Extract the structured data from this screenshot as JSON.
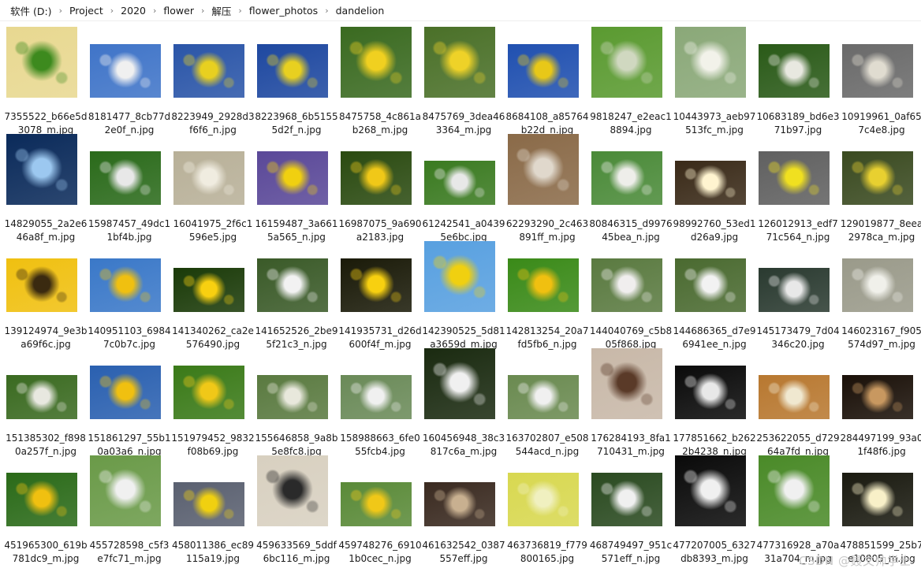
{
  "breadcrumb": [
    "软件 (D:)",
    "Project",
    "2020",
    "flower",
    "解压",
    "flower_photos",
    "dandelion"
  ],
  "files": [
    {
      "name": "7355522_b66e5d3078_m.jpg",
      "bg": "#e8d890",
      "fg": "#3d8a1e",
      "shape": "portrait"
    },
    {
      "name": "8181477_8cb77d2e0f_n.jpg",
      "bg": "#3f74c8",
      "fg": "#f0f0f0",
      "shape": "landscape"
    },
    {
      "name": "8223949_2928d3f6f6_n.jpg",
      "bg": "#2a55a8",
      "fg": "#e8d020",
      "shape": "landscape"
    },
    {
      "name": "8223968_6b51555d2f_n.jpg",
      "bg": "#1e48a0",
      "fg": "#e8d020",
      "shape": "landscape"
    },
    {
      "name": "8475758_4c861ab268_m.jpg",
      "bg": "#3a6a20",
      "fg": "#f0d020",
      "shape": "portrait"
    },
    {
      "name": "8475769_3dea463364_m.jpg",
      "bg": "#4a7028",
      "fg": "#eed228",
      "shape": "portrait"
    },
    {
      "name": "8684108_a85764b22d_n.jpg",
      "bg": "#2050b0",
      "fg": "#e8c818",
      "shape": "landscape"
    },
    {
      "name": "9818247_e2eac18894.jpg",
      "bg": "#5a9a30",
      "fg": "#d0d8c0",
      "shape": "square"
    },
    {
      "name": "10443973_aeb97513fc_m.jpg",
      "bg": "#8aa878",
      "fg": "#f2f2ea",
      "shape": "portrait"
    },
    {
      "name": "10683189_bd6e371b97.jpg",
      "bg": "#2a5a18",
      "fg": "#e8e8e0",
      "shape": "landscape"
    },
    {
      "name": "10919961_0af657c4e8.jpg",
      "bg": "#6a6a6a",
      "fg": "#e0dcd0",
      "shape": "landscape"
    },
    {
      "name": "14829055_2a2e646a8f_m.jpg",
      "bg": "#0a2a5a",
      "fg": "#9cc8f0",
      "shape": "square"
    },
    {
      "name": "15987457_49dc11bf4b.jpg",
      "bg": "#2a6a1a",
      "fg": "#e8e8e8",
      "shape": "landscape"
    },
    {
      "name": "16041975_2f6c1596e5.jpg",
      "bg": "#b8b098",
      "fg": "#f0ece0",
      "shape": "landscape"
    },
    {
      "name": "16159487_3a6615a565_n.jpg",
      "bg": "#5a4898",
      "fg": "#f0d010",
      "shape": "landscape"
    },
    {
      "name": "16987075_9a690a2183.jpg",
      "bg": "#2a4a10",
      "fg": "#f0c818",
      "shape": "landscape"
    },
    {
      "name": "61242541_a04395e6bc.jpg",
      "bg": "#3a7a20",
      "fg": "#e8e8e8",
      "shape": "wide"
    },
    {
      "name": "62293290_2c463891ff_m.jpg",
      "bg": "#8a6a48",
      "fg": "#e0d8cc",
      "shape": "portrait"
    },
    {
      "name": "80846315_d997645bea_n.jpg",
      "bg": "#4a8a38",
      "fg": "#eeeeea",
      "shape": "landscape"
    },
    {
      "name": "98992760_53ed1d26a9.jpg",
      "bg": "#3a2a18",
      "fg": "#fff4d0",
      "shape": "wide"
    },
    {
      "name": "126012913_edf771c564_n.jpg",
      "bg": "#606060",
      "fg": "#f0e020",
      "shape": "landscape"
    },
    {
      "name": "129019877_8eea2978ca_m.jpg",
      "bg": "#3a4a20",
      "fg": "#e8d030",
      "shape": "landscape"
    },
    {
      "name": "139124974_9e3ba69f6c.jpg",
      "bg": "#f0c010",
      "fg": "#3a2a10",
      "shape": "landscape"
    },
    {
      "name": "140951103_69847c0b7c.jpg",
      "bg": "#3a78c8",
      "fg": "#f0c010",
      "shape": "landscape"
    },
    {
      "name": "141340262_ca2e576490.jpg",
      "bg": "#1a3a08",
      "fg": "#f8d010",
      "shape": "wide"
    },
    {
      "name": "141652526_2be95f21c3_n.jpg",
      "bg": "#3a5a28",
      "fg": "#f2f2f2",
      "shape": "landscape"
    },
    {
      "name": "141935731_d26d600f4f_m.jpg",
      "bg": "#1a1a08",
      "fg": "#f8d010",
      "shape": "landscape"
    },
    {
      "name": "142390525_5d81a3659d_m.jpg",
      "bg": "#58a0e0",
      "fg": "#f0d010",
      "shape": "square"
    },
    {
      "name": "142813254_20a7fd5fb6_n.jpg",
      "bg": "#3a8a18",
      "fg": "#f0c010",
      "shape": "landscape"
    },
    {
      "name": "144040769_c5b805f868.jpg",
      "bg": "#5a7a40",
      "fg": "#f0eeee",
      "shape": "landscape"
    },
    {
      "name": "144686365_d7e96941ee_n.jpg",
      "bg": "#4a6a30",
      "fg": "#f2f2f2",
      "shape": "landscape"
    },
    {
      "name": "145173479_7d04346c20.jpg",
      "bg": "#2a3a30",
      "fg": "#e8e8e8",
      "shape": "wide"
    },
    {
      "name": "146023167_f905574d97_m.jpg",
      "bg": "#9a9a8a",
      "fg": "#f0f0ea",
      "shape": "landscape"
    },
    {
      "name": "151385302_f8980a257f_n.jpg",
      "bg": "#3a6a20",
      "fg": "#e8e8e0",
      "shape": "wide"
    },
    {
      "name": "151861297_55b10a03a6_n.jpg",
      "bg": "#2a60b0",
      "fg": "#f0c010",
      "shape": "landscape"
    },
    {
      "name": "151979452_9832f08b69.jpg",
      "bg": "#3a7a18",
      "fg": "#f0c818",
      "shape": "landscape"
    },
    {
      "name": "155646858_9a8b5e8fc8.jpg",
      "bg": "#5a7a40",
      "fg": "#e8e8dc",
      "shape": "wide"
    },
    {
      "name": "158988663_6fe055fcb4.jpg",
      "bg": "#6a8a58",
      "fg": "#f0f0f0",
      "shape": "wide"
    },
    {
      "name": "160456948_38c3817c6a_m.jpg",
      "bg": "#1a2a10",
      "fg": "#f0f0f0",
      "shape": "portrait"
    },
    {
      "name": "163702807_e508544acd_n.jpg",
      "bg": "#6a8a50",
      "fg": "#f0f0f0",
      "shape": "wide"
    },
    {
      "name": "176284193_8fa1710431_m.jpg",
      "bg": "#c8b8a8",
      "fg": "#5a3a28",
      "shape": "portrait"
    },
    {
      "name": "177851662_b2622b4238_n.jpg",
      "bg": "#0a0a0a",
      "fg": "#e8e8e8",
      "shape": "landscape"
    },
    {
      "name": "253622055_d72964a7fd_n.jpg",
      "bg": "#b87830",
      "fg": "#f0e8d0",
      "shape": "wide"
    },
    {
      "name": "284497199_93a01f48f6.jpg",
      "bg": "#1a1008",
      "fg": "#c89860",
      "shape": "wide"
    },
    {
      "name": "451965300_619b781dc9_m.jpg",
      "bg": "#2a6a18",
      "fg": "#f0c010",
      "shape": "landscape"
    },
    {
      "name": "455728598_c5f3e7fc71_m.jpg",
      "bg": "#6a9a48",
      "fg": "#f0f0f0",
      "shape": "portrait"
    },
    {
      "name": "458011386_ec89115a19.jpg",
      "bg": "#5a6070",
      "fg": "#f0d010",
      "shape": "wide"
    },
    {
      "name": "459633569_5ddf6bc116_m.jpg",
      "bg": "#d8d0c0",
      "fg": "#2a2a2a",
      "shape": "square"
    },
    {
      "name": "459748276_69101b0cec_n.jpg",
      "bg": "#5a8a38",
      "fg": "#f0c818",
      "shape": "wide"
    },
    {
      "name": "461632542_0387557eff.jpg",
      "bg": "#3a2a20",
      "fg": "#c8b090",
      "shape": "wide"
    },
    {
      "name": "463736819_f779800165.jpg",
      "bg": "#d8d850",
      "fg": "#f0f0c0",
      "shape": "landscape"
    },
    {
      "name": "468749497_951c571eff_n.jpg",
      "bg": "#2a4a20",
      "fg": "#f0f0f0",
      "shape": "landscape"
    },
    {
      "name": "477207005_6327db8393_m.jpg",
      "bg": "#0a0a0a",
      "fg": "#f0f0f0",
      "shape": "square"
    },
    {
      "name": "477316928_a70a31a704_m.jpg",
      "bg": "#4a8a28",
      "fg": "#f0f0f0",
      "shape": "portrait"
    },
    {
      "name": "478851599_25b7e10805_m.jpg",
      "bg": "#1a1a10",
      "fg": "#f8f0c8",
      "shape": "landscape"
    }
  ],
  "watermark": "CSDN @聂文帅学士"
}
